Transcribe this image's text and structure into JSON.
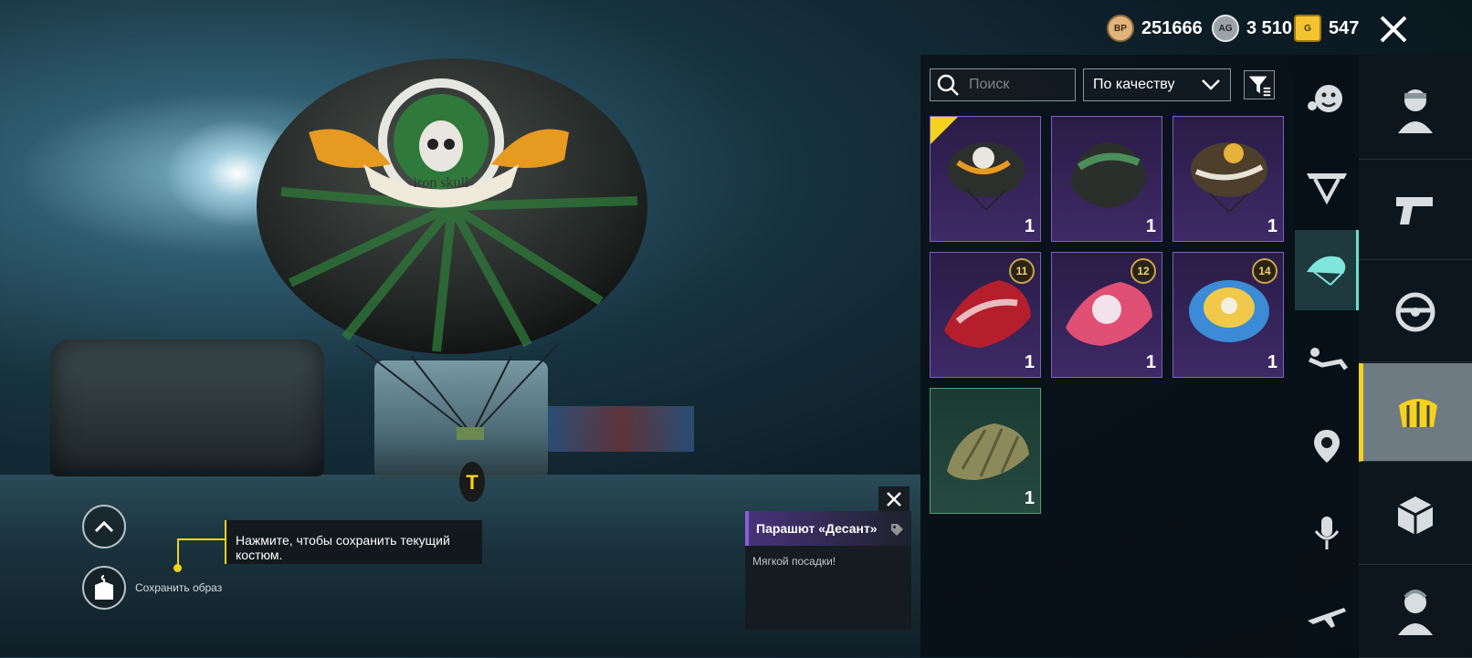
{
  "currencies": [
    {
      "icon": "bp-coin-icon",
      "badge": "BP",
      "value": "251666",
      "color": "#d8a766"
    },
    {
      "icon": "ag-coin-icon",
      "badge": "AG",
      "value": "3 510",
      "color": "#c0c6cc"
    },
    {
      "icon": "g-coin-icon",
      "badge": "G",
      "value": "547",
      "color": "#f4c430"
    }
  ],
  "toolbar": {
    "search_placeholder": "Поиск",
    "sort_label": "По качеству"
  },
  "inventory": {
    "items": [
      {
        "name": "iron-skull-parachute",
        "quantity": "1",
        "level": "",
        "equipped": true,
        "rarity": "epic"
      },
      {
        "name": "black-green-parachute",
        "quantity": "1",
        "level": "",
        "equipped": false,
        "rarity": "epic"
      },
      {
        "name": "brown-badge-parachute",
        "quantity": "1",
        "level": "",
        "equipped": false,
        "rarity": "epic"
      },
      {
        "name": "red-anime-parachute",
        "quantity": "1",
        "level": "11",
        "equipped": false,
        "rarity": "epic"
      },
      {
        "name": "pink-anime-parachute",
        "quantity": "1",
        "level": "12",
        "equipped": false,
        "rarity": "epic"
      },
      {
        "name": "gold-blue-parachute",
        "quantity": "1",
        "level": "14",
        "equipped": false,
        "rarity": "epic"
      },
      {
        "name": "desant-parachute",
        "quantity": "1",
        "level": "",
        "equipped": false,
        "rarity": "common"
      }
    ]
  },
  "categories": [
    "emote",
    "glider",
    "parachute",
    "pose",
    "marker",
    "voice",
    "plane"
  ],
  "main_categories": [
    "outfit",
    "weapon",
    "vehicle",
    "equipment",
    "crate",
    "character"
  ],
  "active_category": "parachute",
  "tip": {
    "text": "Нажмите, чтобы сохранить текущий костюм."
  },
  "save_outfit": {
    "label": "Сохранить образ"
  },
  "canopy_text": "iron skull",
  "item_info": {
    "title": "Парашют «Десант»",
    "description": "Мягкой посадки!"
  }
}
